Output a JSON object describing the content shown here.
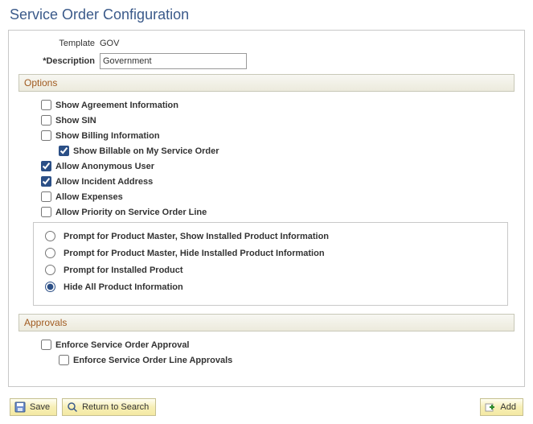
{
  "page_title": "Service Order Configuration",
  "header": {
    "template_label": "Template",
    "template_value": "GOV",
    "description_label": "*Description",
    "description_value": "Government"
  },
  "options": {
    "title": "Options",
    "checkboxes": {
      "show_agreement": {
        "label": "Show Agreement Information",
        "checked": false
      },
      "show_sin": {
        "label": "Show SIN",
        "checked": false
      },
      "show_billing": {
        "label": "Show Billing Information",
        "checked": false
      },
      "show_billable_my_so": {
        "label": "Show Billable on My Service Order",
        "checked": true
      },
      "allow_anon": {
        "label": "Allow Anonymous User",
        "checked": true
      },
      "allow_incident_addr": {
        "label": "Allow Incident Address",
        "checked": true
      },
      "allow_expenses": {
        "label": "Allow Expenses",
        "checked": false
      },
      "allow_priority_line": {
        "label": "Allow Priority on Service Order Line",
        "checked": false
      }
    },
    "radios": [
      {
        "label": "Prompt for Product Master, Show Installed Product Information",
        "checked": false
      },
      {
        "label": "Prompt for Product Master, Hide Installed Product Information",
        "checked": false
      },
      {
        "label": "Prompt for Installed Product",
        "checked": false
      },
      {
        "label": "Hide All Product Information",
        "checked": true
      }
    ]
  },
  "approvals": {
    "title": "Approvals",
    "enforce_so": {
      "label": "Enforce Service Order Approval",
      "checked": false
    },
    "enforce_so_line": {
      "label": "Enforce Service Order Line Approvals",
      "checked": false
    }
  },
  "actions": {
    "save": "Save",
    "return_to_search": "Return to Search",
    "add": "Add"
  }
}
